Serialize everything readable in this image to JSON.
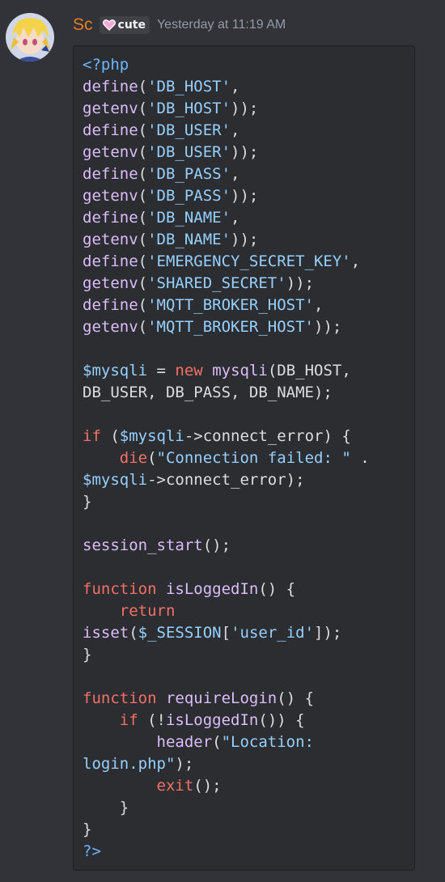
{
  "message": {
    "author": "Sc",
    "role_tag": "cute",
    "timestamp": "Yesterday at 11:19 AM"
  },
  "colors": {
    "background": "#313338",
    "code_background": "#2b2d31",
    "username": "#e67e22",
    "keyword": "#f47067",
    "function": "#dcbdfb",
    "string": "#96d0ff",
    "variable": "#96d0ff",
    "php_tag": "#6cb6ff",
    "plain": "#dbdee1",
    "timestamp": "#949ba4"
  },
  "code": {
    "lines": [
      [
        {
          "t": "tg",
          "v": "<?php"
        }
      ],
      [
        {
          "t": "fn",
          "v": "define"
        },
        {
          "t": "pl",
          "v": "("
        },
        {
          "t": "st",
          "v": "'DB_HOST'"
        },
        {
          "t": "pl",
          "v": ","
        }
      ],
      [
        {
          "t": "fn",
          "v": "getenv"
        },
        {
          "t": "pl",
          "v": "("
        },
        {
          "t": "st",
          "v": "'DB_HOST'"
        },
        {
          "t": "pl",
          "v": "));"
        }
      ],
      [
        {
          "t": "fn",
          "v": "define"
        },
        {
          "t": "pl",
          "v": "("
        },
        {
          "t": "st",
          "v": "'DB_USER'"
        },
        {
          "t": "pl",
          "v": ","
        }
      ],
      [
        {
          "t": "fn",
          "v": "getenv"
        },
        {
          "t": "pl",
          "v": "("
        },
        {
          "t": "st",
          "v": "'DB_USER'"
        },
        {
          "t": "pl",
          "v": "));"
        }
      ],
      [
        {
          "t": "fn",
          "v": "define"
        },
        {
          "t": "pl",
          "v": "("
        },
        {
          "t": "st",
          "v": "'DB_PASS'"
        },
        {
          "t": "pl",
          "v": ","
        }
      ],
      [
        {
          "t": "fn",
          "v": "getenv"
        },
        {
          "t": "pl",
          "v": "("
        },
        {
          "t": "st",
          "v": "'DB_PASS'"
        },
        {
          "t": "pl",
          "v": "));"
        }
      ],
      [
        {
          "t": "fn",
          "v": "define"
        },
        {
          "t": "pl",
          "v": "("
        },
        {
          "t": "st",
          "v": "'DB_NAME'"
        },
        {
          "t": "pl",
          "v": ","
        }
      ],
      [
        {
          "t": "fn",
          "v": "getenv"
        },
        {
          "t": "pl",
          "v": "("
        },
        {
          "t": "st",
          "v": "'DB_NAME'"
        },
        {
          "t": "pl",
          "v": "));"
        }
      ],
      [
        {
          "t": "fn",
          "v": "define"
        },
        {
          "t": "pl",
          "v": "("
        },
        {
          "t": "st",
          "v": "'EMERGENCY_SECRET_KEY'"
        },
        {
          "t": "pl",
          "v": ","
        }
      ],
      [
        {
          "t": "fn",
          "v": "getenv"
        },
        {
          "t": "pl",
          "v": "("
        },
        {
          "t": "st",
          "v": "'SHARED_SECRET'"
        },
        {
          "t": "pl",
          "v": "));"
        }
      ],
      [
        {
          "t": "fn",
          "v": "define"
        },
        {
          "t": "pl",
          "v": "("
        },
        {
          "t": "st",
          "v": "'MQTT_BROKER_HOST'"
        },
        {
          "t": "pl",
          "v": ","
        }
      ],
      [
        {
          "t": "fn",
          "v": "getenv"
        },
        {
          "t": "pl",
          "v": "("
        },
        {
          "t": "st",
          "v": "'MQTT_BROKER_HOST'"
        },
        {
          "t": "pl",
          "v": "));"
        }
      ],
      [],
      [
        {
          "t": "vr",
          "v": "$mysqli"
        },
        {
          "t": "pl",
          "v": " = "
        },
        {
          "t": "kw",
          "v": "new"
        },
        {
          "t": "pl",
          "v": " "
        },
        {
          "t": "fn",
          "v": "mysqli"
        },
        {
          "t": "pl",
          "v": "(DB_HOST,"
        }
      ],
      [
        {
          "t": "pl",
          "v": "DB_USER, DB_PASS, DB_NAME);"
        }
      ],
      [],
      [
        {
          "t": "kw",
          "v": "if"
        },
        {
          "t": "pl",
          "v": " ("
        },
        {
          "t": "vr",
          "v": "$mysqli"
        },
        {
          "t": "pl",
          "v": "->connect_error) {"
        }
      ],
      [
        {
          "t": "pl",
          "v": "    "
        },
        {
          "t": "kw",
          "v": "die"
        },
        {
          "t": "pl",
          "v": "("
        },
        {
          "t": "st",
          "v": "\"Connection failed: \""
        },
        {
          "t": "pl",
          "v": " ."
        }
      ],
      [
        {
          "t": "vr",
          "v": "$mysqli"
        },
        {
          "t": "pl",
          "v": "->connect_error);"
        }
      ],
      [
        {
          "t": "pl",
          "v": "}"
        }
      ],
      [],
      [
        {
          "t": "fn",
          "v": "session_start"
        },
        {
          "t": "pl",
          "v": "();"
        }
      ],
      [],
      [
        {
          "t": "kw",
          "v": "function"
        },
        {
          "t": "pl",
          "v": " "
        },
        {
          "t": "fn",
          "v": "isLoggedIn"
        },
        {
          "t": "pl",
          "v": "() {"
        }
      ],
      [
        {
          "t": "pl",
          "v": "    "
        },
        {
          "t": "kw",
          "v": "return"
        }
      ],
      [
        {
          "t": "fn",
          "v": "isset"
        },
        {
          "t": "pl",
          "v": "("
        },
        {
          "t": "vr",
          "v": "$_SESSION"
        },
        {
          "t": "pl",
          "v": "["
        },
        {
          "t": "st",
          "v": "'user_id'"
        },
        {
          "t": "pl",
          "v": "]);"
        }
      ],
      [
        {
          "t": "pl",
          "v": "}"
        }
      ],
      [],
      [
        {
          "t": "kw",
          "v": "function"
        },
        {
          "t": "pl",
          "v": " "
        },
        {
          "t": "fn",
          "v": "requireLogin"
        },
        {
          "t": "pl",
          "v": "() {"
        }
      ],
      [
        {
          "t": "pl",
          "v": "    "
        },
        {
          "t": "kw",
          "v": "if"
        },
        {
          "t": "pl",
          "v": " (!"
        },
        {
          "t": "fn",
          "v": "isLoggedIn"
        },
        {
          "t": "pl",
          "v": "()) {"
        }
      ],
      [
        {
          "t": "pl",
          "v": "        "
        },
        {
          "t": "fn",
          "v": "header"
        },
        {
          "t": "pl",
          "v": "("
        },
        {
          "t": "st",
          "v": "\"Location:"
        }
      ],
      [
        {
          "t": "st",
          "v": "login.php\""
        },
        {
          "t": "pl",
          "v": ");"
        }
      ],
      [
        {
          "t": "pl",
          "v": "        "
        },
        {
          "t": "kw",
          "v": "exit"
        },
        {
          "t": "pl",
          "v": "();"
        }
      ],
      [
        {
          "t": "pl",
          "v": "    }"
        }
      ],
      [
        {
          "t": "pl",
          "v": "}"
        }
      ],
      [
        {
          "t": "tg",
          "v": "?>"
        }
      ]
    ]
  }
}
